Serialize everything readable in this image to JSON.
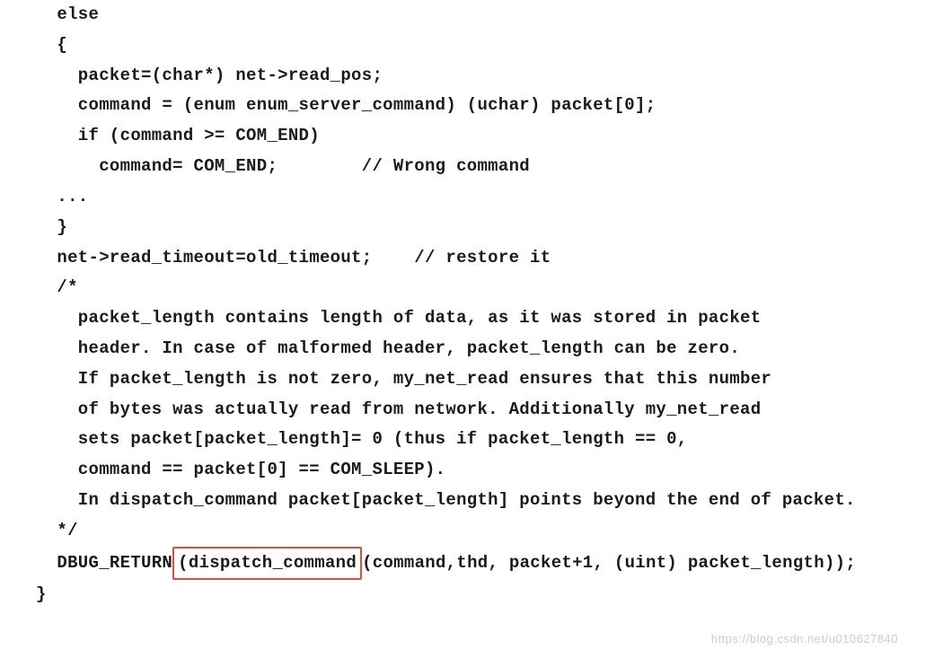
{
  "code": {
    "line1": "  else",
    "line2": "  {",
    "line3": "    packet=(char*) net->read_pos;",
    "line4": "    command = (enum enum_server_command) (uchar) packet[0];",
    "line5": "    if (command >= COM_END)",
    "line6": "      command= COM_END;        // Wrong command",
    "line7": "",
    "line8": "  ...",
    "line9": "",
    "line10": "  }",
    "line11": "  net->read_timeout=old_timeout;    // restore it",
    "line12": "  /*",
    "line13": "    packet_length contains length of data, as it was stored in packet",
    "line14": "    header. In case of malformed header, packet_length can be zero.",
    "line15": "    If packet_length is not zero, my_net_read ensures that this number",
    "line16": "    of bytes was actually read from network. Additionally my_net_read",
    "line17": "    sets packet[packet_length]= 0 (thus if packet_length == 0,",
    "line18": "    command == packet[0] == COM_SLEEP).",
    "line19": "    In dispatch_command packet[packet_length] points beyond the end of packet.",
    "line20": "  */",
    "line21_pre": "  DBUG_RETURN",
    "line21_highlight": "(dispatch_command",
    "line21_post": "(command,thd, packet+1, (uint) packet_length));",
    "line22": "}"
  },
  "watermark": "https://blog.csdn.net/u010627840"
}
